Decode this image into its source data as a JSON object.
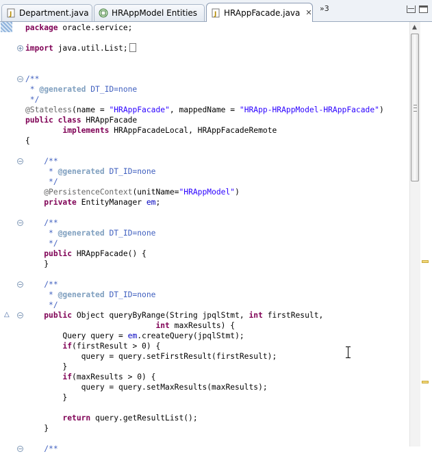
{
  "tabs": [
    {
      "label": "Department.java",
      "icon": "java-file-icon",
      "active": false
    },
    {
      "label": "HRAppModel Entities",
      "icon": "entity-diagram-icon",
      "active": false
    },
    {
      "label": "HRAppFacade.java",
      "icon": "java-file-icon",
      "active": true
    }
  ],
  "overflow_label": "»3",
  "code_lines": [
    {
      "type": "code",
      "parts": [
        [
          "kw",
          "package"
        ],
        [
          "",
          "oracle.service;"
        ]
      ]
    },
    {
      "type": "blank"
    },
    {
      "type": "code",
      "fold": "+",
      "parts": [
        [
          "kw",
          "import"
        ],
        [
          "",
          "java.util.List;"
        ],
        [
          "box",
          ""
        ]
      ]
    },
    {
      "type": "blank"
    },
    {
      "type": "blank"
    },
    {
      "type": "code",
      "fold": "-",
      "parts": [
        [
          "cmt",
          "/**"
        ]
      ]
    },
    {
      "type": "code",
      "parts": [
        [
          "cmt",
          " * "
        ],
        [
          "tag",
          "@generated"
        ],
        [
          "cmt",
          " DT_ID=none"
        ]
      ]
    },
    {
      "type": "code",
      "parts": [
        [
          "cmt",
          " */"
        ]
      ]
    },
    {
      "type": "code",
      "parts": [
        [
          "ann",
          "@Stateless"
        ],
        [
          "",
          "(name = "
        ],
        [
          "str",
          "\"HRAppFacade\""
        ],
        [
          "",
          ", mappedName = "
        ],
        [
          "str",
          "\"HRApp-HRAppModel-HRAppFacade\""
        ],
        [
          "",
          ")"
        ]
      ]
    },
    {
      "type": "code",
      "parts": [
        [
          "kw",
          "public class"
        ],
        [
          "",
          "HRAppFacade"
        ]
      ]
    },
    {
      "type": "code",
      "parts": [
        [
          "",
          "        "
        ],
        [
          "kw",
          "implements"
        ],
        [
          "",
          "HRAppFacadeLocal, HRAppFacadeRemote"
        ]
      ]
    },
    {
      "type": "code",
      "parts": [
        [
          "",
          "{"
        ]
      ]
    },
    {
      "type": "blank"
    },
    {
      "type": "code",
      "fold": "-",
      "parts": [
        [
          "",
          "    "
        ],
        [
          "cmt",
          "/**"
        ]
      ]
    },
    {
      "type": "code",
      "parts": [
        [
          "",
          "    "
        ],
        [
          "cmt",
          " * "
        ],
        [
          "tag",
          "@generated"
        ],
        [
          "cmt",
          " DT_ID=none"
        ]
      ]
    },
    {
      "type": "code",
      "parts": [
        [
          "",
          "    "
        ],
        [
          "cmt",
          " */"
        ]
      ]
    },
    {
      "type": "code",
      "parts": [
        [
          "",
          "    "
        ],
        [
          "ann",
          "@PersistenceContext"
        ],
        [
          "",
          "(unitName="
        ],
        [
          "str",
          "\"HRAppModel\""
        ],
        [
          "",
          ")"
        ]
      ]
    },
    {
      "type": "code",
      "parts": [
        [
          "",
          "    "
        ],
        [
          "kw",
          "private"
        ],
        [
          "",
          "EntityManager "
        ],
        [
          "fld",
          "em"
        ],
        [
          "",
          ";"
        ]
      ]
    },
    {
      "type": "blank"
    },
    {
      "type": "code",
      "fold": "-",
      "parts": [
        [
          "",
          "    "
        ],
        [
          "cmt",
          "/**"
        ]
      ]
    },
    {
      "type": "code",
      "parts": [
        [
          "",
          "    "
        ],
        [
          "cmt",
          " * "
        ],
        [
          "tag",
          "@generated"
        ],
        [
          "cmt",
          " DT_ID=none"
        ]
      ]
    },
    {
      "type": "code",
      "parts": [
        [
          "",
          "    "
        ],
        [
          "cmt",
          " */"
        ]
      ]
    },
    {
      "type": "code",
      "parts": [
        [
          "",
          "    "
        ],
        [
          "kw",
          "public"
        ],
        [
          "",
          "HRAppFacade() {"
        ]
      ]
    },
    {
      "type": "code",
      "parts": [
        [
          "",
          "    }"
        ]
      ]
    },
    {
      "type": "blank"
    },
    {
      "type": "code",
      "fold": "-",
      "parts": [
        [
          "",
          "    "
        ],
        [
          "cmt",
          "/**"
        ]
      ]
    },
    {
      "type": "code",
      "parts": [
        [
          "",
          "    "
        ],
        [
          "cmt",
          " * "
        ],
        [
          "tag",
          "@generated"
        ],
        [
          "cmt",
          " DT_ID=none"
        ]
      ]
    },
    {
      "type": "code",
      "parts": [
        [
          "",
          "    "
        ],
        [
          "cmt",
          " */"
        ]
      ]
    },
    {
      "type": "code",
      "fold": "-",
      "override": true,
      "parts": [
        [
          "",
          "    "
        ],
        [
          "kw",
          "public"
        ],
        [
          "",
          "Object queryByRange(String jpqlStmt, "
        ],
        [
          "kw",
          "int"
        ],
        [
          "",
          "firstResult,"
        ]
      ]
    },
    {
      "type": "code",
      "parts": [
        [
          "",
          "                            "
        ],
        [
          "kw",
          "int"
        ],
        [
          "",
          "maxResults) {"
        ]
      ]
    },
    {
      "type": "code",
      "parts": [
        [
          "",
          "        Query query = "
        ],
        [
          "fld",
          "em"
        ],
        [
          "",
          ".createQuery(jpqlStmt);"
        ]
      ]
    },
    {
      "type": "code",
      "parts": [
        [
          "",
          "        "
        ],
        [
          "kw",
          "if"
        ],
        [
          "",
          "(firstResult > 0) {"
        ]
      ]
    },
    {
      "type": "code",
      "parts": [
        [
          "",
          "            query = query.setFirstResult(firstResult);"
        ]
      ]
    },
    {
      "type": "code",
      "parts": [
        [
          "",
          "        }"
        ]
      ]
    },
    {
      "type": "code",
      "parts": [
        [
          "",
          "        "
        ],
        [
          "kw",
          "if"
        ],
        [
          "",
          "(maxResults > 0) {"
        ]
      ]
    },
    {
      "type": "code",
      "parts": [
        [
          "",
          "            query = query.setMaxResults(maxResults);"
        ]
      ]
    },
    {
      "type": "code",
      "parts": [
        [
          "",
          "        }"
        ]
      ]
    },
    {
      "type": "blank"
    },
    {
      "type": "code",
      "parts": [
        [
          "",
          "        "
        ],
        [
          "kw",
          "return"
        ],
        [
          "",
          "query.getResultList();"
        ]
      ]
    },
    {
      "type": "code",
      "parts": [
        [
          "",
          "    }"
        ]
      ]
    },
    {
      "type": "blank"
    },
    {
      "type": "code",
      "fold": "-",
      "parts": [
        [
          "",
          "    "
        ],
        [
          "cmt",
          "/**"
        ]
      ]
    }
  ],
  "overview_marks": [
    "warning-marker",
    "warning-marker"
  ]
}
